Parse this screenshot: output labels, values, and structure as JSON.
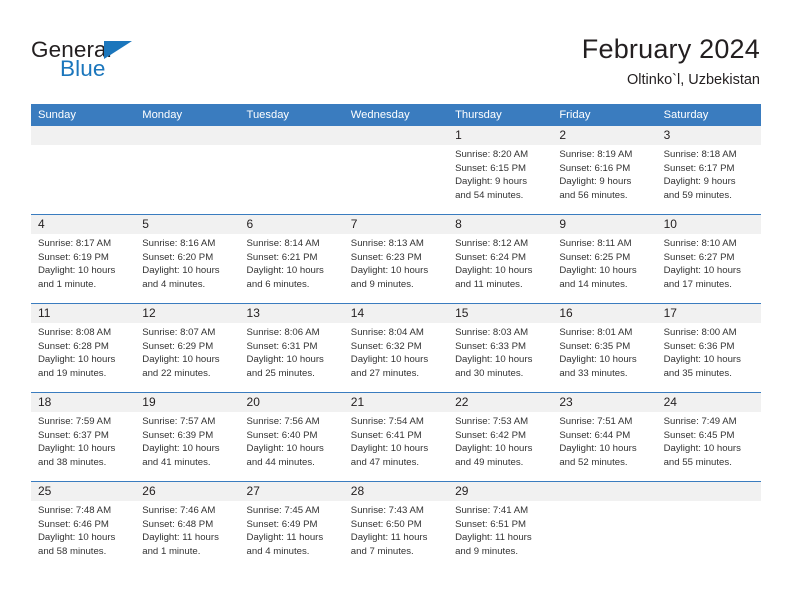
{
  "brand": {
    "name_top": "General",
    "name_bottom": "Blue",
    "accent_color": "#1b76bc"
  },
  "header": {
    "title": "February 2024",
    "subtitle": "Oltinko`l, Uzbekistan"
  },
  "theme": {
    "header_bar_color": "#3a7cbf",
    "day_band_color": "#f1f1f1",
    "text_color": "#231f20"
  },
  "weekdays": [
    "Sunday",
    "Monday",
    "Tuesday",
    "Wednesday",
    "Thursday",
    "Friday",
    "Saturday"
  ],
  "weeks": [
    [
      {
        "day": "",
        "sunrise": "",
        "sunset": "",
        "daylight_line1": "",
        "daylight_line2": ""
      },
      {
        "day": "",
        "sunrise": "",
        "sunset": "",
        "daylight_line1": "",
        "daylight_line2": ""
      },
      {
        "day": "",
        "sunrise": "",
        "sunset": "",
        "daylight_line1": "",
        "daylight_line2": ""
      },
      {
        "day": "",
        "sunrise": "",
        "sunset": "",
        "daylight_line1": "",
        "daylight_line2": ""
      },
      {
        "day": "1",
        "sunrise": "Sunrise: 8:20 AM",
        "sunset": "Sunset: 6:15 PM",
        "daylight_line1": "Daylight: 9 hours",
        "daylight_line2": "and 54 minutes."
      },
      {
        "day": "2",
        "sunrise": "Sunrise: 8:19 AM",
        "sunset": "Sunset: 6:16 PM",
        "daylight_line1": "Daylight: 9 hours",
        "daylight_line2": "and 56 minutes."
      },
      {
        "day": "3",
        "sunrise": "Sunrise: 8:18 AM",
        "sunset": "Sunset: 6:17 PM",
        "daylight_line1": "Daylight: 9 hours",
        "daylight_line2": "and 59 minutes."
      }
    ],
    [
      {
        "day": "4",
        "sunrise": "Sunrise: 8:17 AM",
        "sunset": "Sunset: 6:19 PM",
        "daylight_line1": "Daylight: 10 hours",
        "daylight_line2": "and 1 minute."
      },
      {
        "day": "5",
        "sunrise": "Sunrise: 8:16 AM",
        "sunset": "Sunset: 6:20 PM",
        "daylight_line1": "Daylight: 10 hours",
        "daylight_line2": "and 4 minutes."
      },
      {
        "day": "6",
        "sunrise": "Sunrise: 8:14 AM",
        "sunset": "Sunset: 6:21 PM",
        "daylight_line1": "Daylight: 10 hours",
        "daylight_line2": "and 6 minutes."
      },
      {
        "day": "7",
        "sunrise": "Sunrise: 8:13 AM",
        "sunset": "Sunset: 6:23 PM",
        "daylight_line1": "Daylight: 10 hours",
        "daylight_line2": "and 9 minutes."
      },
      {
        "day": "8",
        "sunrise": "Sunrise: 8:12 AM",
        "sunset": "Sunset: 6:24 PM",
        "daylight_line1": "Daylight: 10 hours",
        "daylight_line2": "and 11 minutes."
      },
      {
        "day": "9",
        "sunrise": "Sunrise: 8:11 AM",
        "sunset": "Sunset: 6:25 PM",
        "daylight_line1": "Daylight: 10 hours",
        "daylight_line2": "and 14 minutes."
      },
      {
        "day": "10",
        "sunrise": "Sunrise: 8:10 AM",
        "sunset": "Sunset: 6:27 PM",
        "daylight_line1": "Daylight: 10 hours",
        "daylight_line2": "and 17 minutes."
      }
    ],
    [
      {
        "day": "11",
        "sunrise": "Sunrise: 8:08 AM",
        "sunset": "Sunset: 6:28 PM",
        "daylight_line1": "Daylight: 10 hours",
        "daylight_line2": "and 19 minutes."
      },
      {
        "day": "12",
        "sunrise": "Sunrise: 8:07 AM",
        "sunset": "Sunset: 6:29 PM",
        "daylight_line1": "Daylight: 10 hours",
        "daylight_line2": "and 22 minutes."
      },
      {
        "day": "13",
        "sunrise": "Sunrise: 8:06 AM",
        "sunset": "Sunset: 6:31 PM",
        "daylight_line1": "Daylight: 10 hours",
        "daylight_line2": "and 25 minutes."
      },
      {
        "day": "14",
        "sunrise": "Sunrise: 8:04 AM",
        "sunset": "Sunset: 6:32 PM",
        "daylight_line1": "Daylight: 10 hours",
        "daylight_line2": "and 27 minutes."
      },
      {
        "day": "15",
        "sunrise": "Sunrise: 8:03 AM",
        "sunset": "Sunset: 6:33 PM",
        "daylight_line1": "Daylight: 10 hours",
        "daylight_line2": "and 30 minutes."
      },
      {
        "day": "16",
        "sunrise": "Sunrise: 8:01 AM",
        "sunset": "Sunset: 6:35 PM",
        "daylight_line1": "Daylight: 10 hours",
        "daylight_line2": "and 33 minutes."
      },
      {
        "day": "17",
        "sunrise": "Sunrise: 8:00 AM",
        "sunset": "Sunset: 6:36 PM",
        "daylight_line1": "Daylight: 10 hours",
        "daylight_line2": "and 35 minutes."
      }
    ],
    [
      {
        "day": "18",
        "sunrise": "Sunrise: 7:59 AM",
        "sunset": "Sunset: 6:37 PM",
        "daylight_line1": "Daylight: 10 hours",
        "daylight_line2": "and 38 minutes."
      },
      {
        "day": "19",
        "sunrise": "Sunrise: 7:57 AM",
        "sunset": "Sunset: 6:39 PM",
        "daylight_line1": "Daylight: 10 hours",
        "daylight_line2": "and 41 minutes."
      },
      {
        "day": "20",
        "sunrise": "Sunrise: 7:56 AM",
        "sunset": "Sunset: 6:40 PM",
        "daylight_line1": "Daylight: 10 hours",
        "daylight_line2": "and 44 minutes."
      },
      {
        "day": "21",
        "sunrise": "Sunrise: 7:54 AM",
        "sunset": "Sunset: 6:41 PM",
        "daylight_line1": "Daylight: 10 hours",
        "daylight_line2": "and 47 minutes."
      },
      {
        "day": "22",
        "sunrise": "Sunrise: 7:53 AM",
        "sunset": "Sunset: 6:42 PM",
        "daylight_line1": "Daylight: 10 hours",
        "daylight_line2": "and 49 minutes."
      },
      {
        "day": "23",
        "sunrise": "Sunrise: 7:51 AM",
        "sunset": "Sunset: 6:44 PM",
        "daylight_line1": "Daylight: 10 hours",
        "daylight_line2": "and 52 minutes."
      },
      {
        "day": "24",
        "sunrise": "Sunrise: 7:49 AM",
        "sunset": "Sunset: 6:45 PM",
        "daylight_line1": "Daylight: 10 hours",
        "daylight_line2": "and 55 minutes."
      }
    ],
    [
      {
        "day": "25",
        "sunrise": "Sunrise: 7:48 AM",
        "sunset": "Sunset: 6:46 PM",
        "daylight_line1": "Daylight: 10 hours",
        "daylight_line2": "and 58 minutes."
      },
      {
        "day": "26",
        "sunrise": "Sunrise: 7:46 AM",
        "sunset": "Sunset: 6:48 PM",
        "daylight_line1": "Daylight: 11 hours",
        "daylight_line2": "and 1 minute."
      },
      {
        "day": "27",
        "sunrise": "Sunrise: 7:45 AM",
        "sunset": "Sunset: 6:49 PM",
        "daylight_line1": "Daylight: 11 hours",
        "daylight_line2": "and 4 minutes."
      },
      {
        "day": "28",
        "sunrise": "Sunrise: 7:43 AM",
        "sunset": "Sunset: 6:50 PM",
        "daylight_line1": "Daylight: 11 hours",
        "daylight_line2": "and 7 minutes."
      },
      {
        "day": "29",
        "sunrise": "Sunrise: 7:41 AM",
        "sunset": "Sunset: 6:51 PM",
        "daylight_line1": "Daylight: 11 hours",
        "daylight_line2": "and 9 minutes."
      },
      {
        "day": "",
        "sunrise": "",
        "sunset": "",
        "daylight_line1": "",
        "daylight_line2": ""
      },
      {
        "day": "",
        "sunrise": "",
        "sunset": "",
        "daylight_line1": "",
        "daylight_line2": ""
      }
    ]
  ]
}
